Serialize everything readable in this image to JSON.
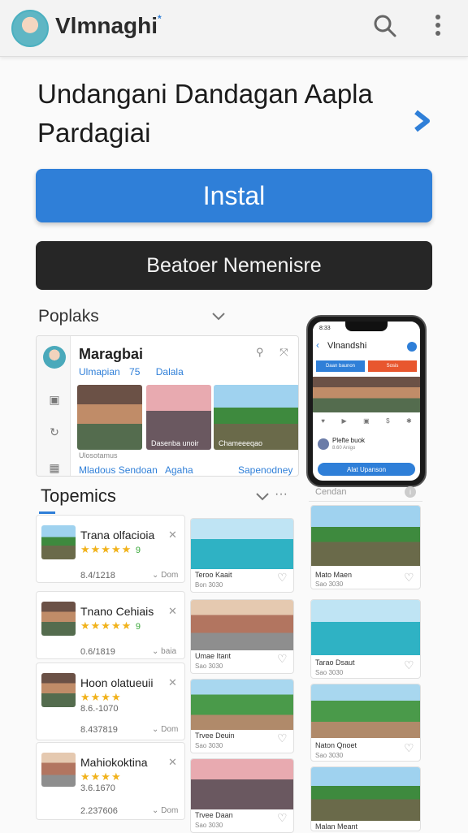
{
  "app": {
    "title": "Vlmnaghi",
    "title_mark": "*"
  },
  "headline": {
    "line1": "Undangani Dandagan Aapla",
    "line2": "Pardagiai"
  },
  "buttons": {
    "install": "Instal",
    "secondary": "Beatoer Nemenisre"
  },
  "popular": {
    "label": "Poplaks"
  },
  "card": {
    "title": "Maragbai",
    "meta_left": "Ulmapian",
    "meta_mid": "75",
    "meta_right": "Dalala",
    "photo_caption": "Dasenba unoir",
    "photo_caption2": "Chameeeqao",
    "sub": "Ulosotamus",
    "names": [
      "Mladous Sendoan",
      "Agaha",
      "Sapenodney"
    ]
  },
  "phone": {
    "status_time": "8:33",
    "title": "Vlnandshi",
    "btn_left": "Daan baunon",
    "btn_right": "Sosis",
    "post_title": "Plefte buok",
    "post_sub": "8.60 Anigo",
    "cta": "Alat Upanson"
  },
  "topemics": {
    "label": "Topemics"
  },
  "list": [
    {
      "title": "Trana olfacioia",
      "num": "8.4/1218",
      "action": "Dom"
    },
    {
      "title": "Tnano Cehiais",
      "num": "0.6/1819",
      "action": "baia"
    },
    {
      "title": "Hoon olatueuii",
      "num": "8.437819",
      "action": "Dom"
    },
    {
      "title": "Mahiokoktina",
      "num": "2.237606",
      "action": "Dom"
    }
  ],
  "list_aux": [
    "9",
    "9",
    "8.6.-1070",
    "3.6.1670"
  ],
  "tiles_mid": [
    {
      "t1": "Teroo Kaait",
      "t2": "Bon 3030"
    },
    {
      "t1": "Umae Itant",
      "t2": "Sao 3030"
    },
    {
      "t1": "Trvee Deuin",
      "t2": "Sao 3030"
    },
    {
      "t1": "Trvee Daan",
      "t2": "Sao 3030"
    }
  ],
  "col3": {
    "label": "Cendan"
  },
  "tiles_right": [
    {
      "t1": "Mato Maen",
      "t2": "Sao 3030"
    },
    {
      "t1": "Tarao Dsaut",
      "t2": "Sao 3030"
    },
    {
      "t1": "Naton Qnoet",
      "t2": "Sao 3030"
    },
    {
      "t1": "Malan Meant",
      "t2": ""
    }
  ],
  "colors": {
    "primary": "#2f7fd8",
    "dark": "#262626",
    "danger": "#e8562e",
    "star": "#f1b21b"
  }
}
